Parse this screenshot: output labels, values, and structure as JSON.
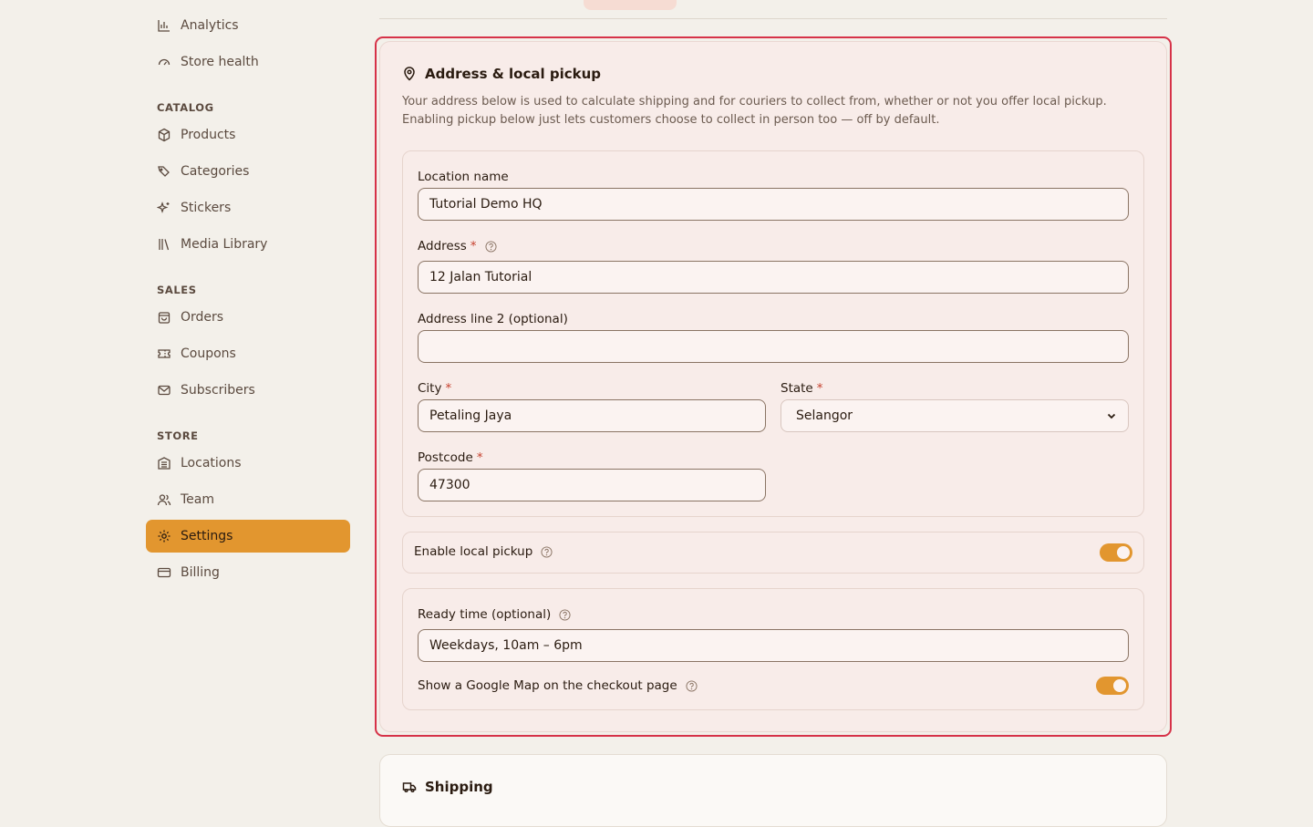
{
  "sidebar": {
    "top_items": [
      {
        "label": "Analytics",
        "icon": "bar-chart-icon"
      },
      {
        "label": "Store health",
        "icon": "gauge-icon"
      }
    ],
    "sections": [
      {
        "label": "CATALOG",
        "items": [
          {
            "label": "Products",
            "icon": "box-icon"
          },
          {
            "label": "Categories",
            "icon": "tags-icon"
          },
          {
            "label": "Stickers",
            "icon": "sparkles-icon"
          },
          {
            "label": "Media Library",
            "icon": "library-icon"
          }
        ]
      },
      {
        "label": "SALES",
        "items": [
          {
            "label": "Orders",
            "icon": "shopping-bag-icon"
          },
          {
            "label": "Coupons",
            "icon": "ticket-icon"
          },
          {
            "label": "Subscribers",
            "icon": "mail-icon"
          }
        ]
      },
      {
        "label": "STORE",
        "items": [
          {
            "label": "Locations",
            "icon": "building-icon"
          },
          {
            "label": "Team",
            "icon": "users-icon"
          },
          {
            "label": "Settings",
            "icon": "gear-icon",
            "active": true
          },
          {
            "label": "Billing",
            "icon": "credit-card-icon"
          }
        ]
      }
    ]
  },
  "address_card": {
    "title": "Address & local pickup",
    "description": "Your address below is used to calculate shipping and for couriers to collect from, whether or not you offer local pickup. Enabling pickup below just lets customers choose to collect in person too — off by default.",
    "fields": {
      "location_name": {
        "label": "Location name",
        "value": "Tutorial Demo HQ"
      },
      "address": {
        "label": "Address",
        "required": "*",
        "value": "12 Jalan Tutorial"
      },
      "address2": {
        "label": "Address line 2 (optional)",
        "value": ""
      },
      "city": {
        "label": "City",
        "required": "*",
        "value": "Petaling Jaya"
      },
      "state": {
        "label": "State",
        "required": "*",
        "value": "Selangor"
      },
      "postcode": {
        "label": "Postcode",
        "required": "*",
        "value": "47300"
      }
    },
    "local_pickup": {
      "label": "Enable local pickup",
      "enabled": true
    },
    "ready_time": {
      "label": "Ready time (optional)",
      "value": "Weekdays, 10am – 6pm"
    },
    "google_map": {
      "label": "Show a Google Map on the checkout page",
      "enabled": true
    }
  },
  "shipping_card": {
    "title": "Shipping"
  },
  "colors": {
    "accent": "#e2962f",
    "highlight": "#d63248",
    "card_bg": "#f8ece9",
    "page_bg": "#f3f0ea"
  }
}
